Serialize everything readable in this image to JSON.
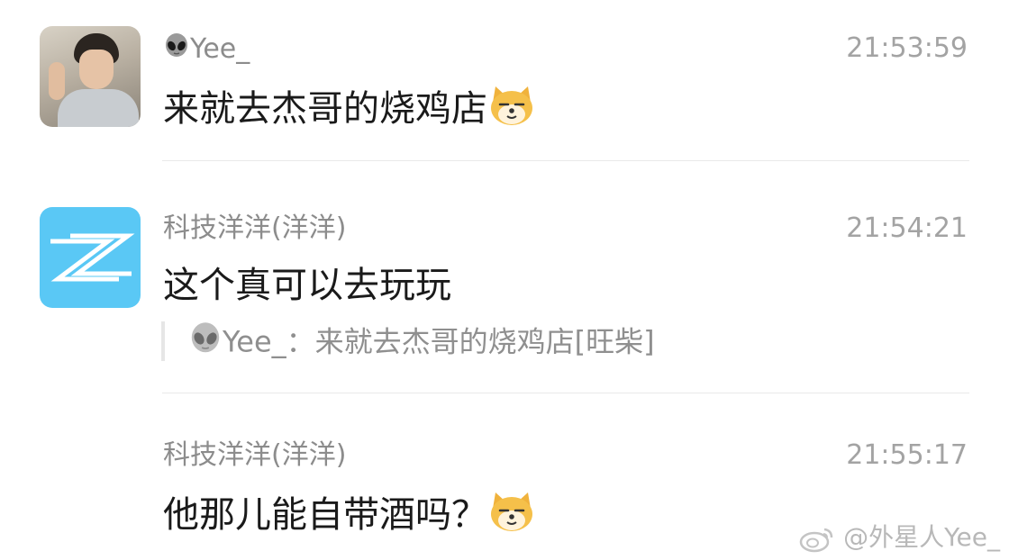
{
  "messages": [
    {
      "sender": "Yee_",
      "sender_icon": "alien-icon",
      "time": "21:53:59",
      "text": "来就去杰哥的烧鸡店",
      "emoji": "shiba-dog-emoji"
    },
    {
      "sender": "科技洋洋(洋洋)",
      "time": "21:54:21",
      "text": "这个真可以去玩玩",
      "quote": {
        "icon": "alien-icon",
        "text": "Yee_：来就去杰哥的烧鸡店[旺柴]"
      }
    },
    {
      "sender": "科技洋洋(洋洋)",
      "time": "21:55:17",
      "text": "他那儿能自带酒吗？",
      "emoji": "shiba-dog-emoji"
    }
  ],
  "watermark": "@外星人Yee_",
  "colors": {
    "logo_avatar_bg": "#5ac8f5",
    "time_text": "#a3a3a3",
    "name_text": "#8c8c8c"
  }
}
